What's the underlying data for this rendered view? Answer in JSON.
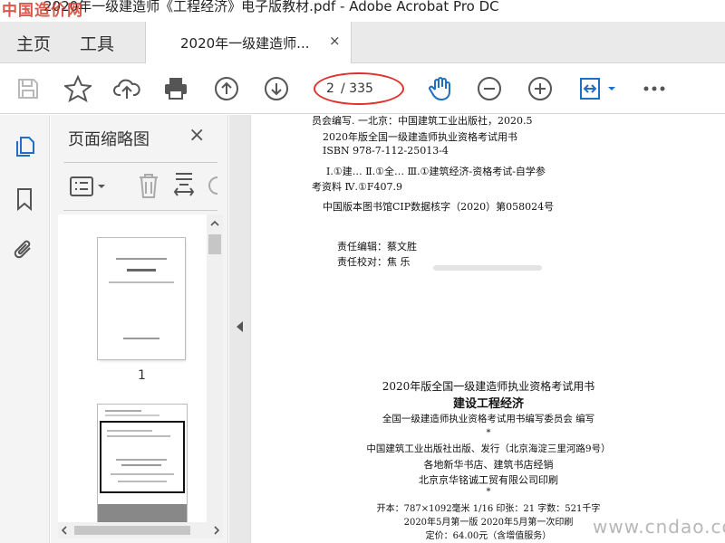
{
  "app": {
    "watermark_top": "中国造价网",
    "window_title": "2020年一级建造师《工程经济》电子版教材.pdf - Adobe Acrobat Pro DC"
  },
  "menu": {
    "home": "主页",
    "tools": "工具",
    "doc_tab_label": "2020年一级建造师...",
    "doc_tab_close": "×"
  },
  "toolbar": {
    "page_current": "2",
    "page_total": "/ 335",
    "accent": "#1f6fc4",
    "annotation_color": "#e0302a",
    "icons": [
      "save-icon",
      "star-icon",
      "cloud-upload-icon",
      "print-icon",
      "page-up-icon",
      "page-down-icon",
      "hand-icon",
      "zoom-out-icon",
      "zoom-in-icon",
      "fit-page-icon",
      "more-icon"
    ]
  },
  "leftnav": {
    "icons": [
      "page-thumbnails-icon",
      "bookmark-icon",
      "attachment-icon"
    ]
  },
  "thumbnails": {
    "title": "页面缩略图",
    "close": "×",
    "page1_label": "1",
    "thumb1_title": "建设工程经济"
  },
  "document": {
    "lines": [
      "员会编写. 一北京：中国建筑工业出版社，2020.5",
      "2020年版全国一级建造师执业资格考试用书",
      "ISBN 978-7-112-25013-4",
      "Ⅰ.①建…   Ⅱ.①全…   Ⅲ.①建筑经济-资格考试-自学参",
      "考资料   Ⅳ.①F407.9",
      "中国版本图书馆CIP数据核字（2020）第058024号",
      "责任编辑：蔡文胜",
      "责任校对：焦   乐"
    ],
    "colophon": {
      "series": "2020年版全国一级建造师执业资格考试用书",
      "book_title": "建设工程经济",
      "editor": "全国一级建造师执业资格考试用书编写委员会   编写",
      "star1": "*",
      "publisher": "中国建筑工业出版社出版、发行（北京海淀三里河路9号）",
      "distributor": "各地新华书店、建筑书店经销",
      "printer": "北京京华铭诚工贸有限公司印刷",
      "star2": "*",
      "format": "开本：787×1092毫米   1/16   印张：21   字数：521千字",
      "edition": "2020年5月第一版      2020年5月第一次印刷",
      "price": "定价：64.00元（含增值服务）"
    },
    "watermark_bottom": "www.cndao.com"
  }
}
